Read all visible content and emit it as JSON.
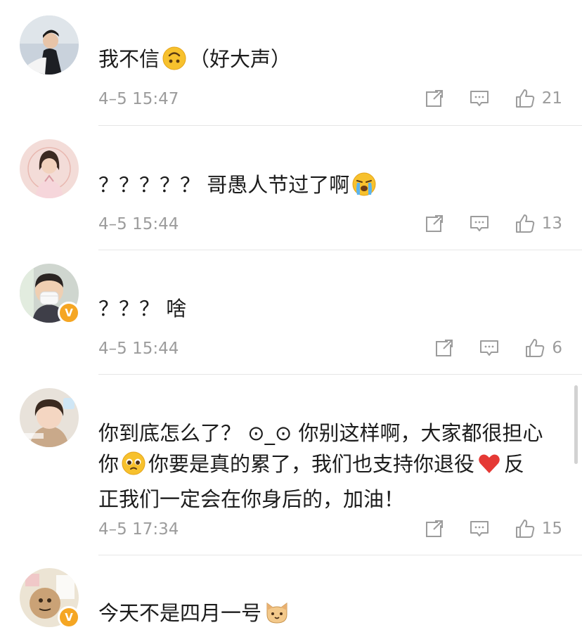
{
  "comments": [
    {
      "text_parts": [
        "我不信",
        "（好大声）"
      ],
      "emoji": "upside-down-face",
      "time": "4–5 15:47",
      "likes": "21",
      "verified": false
    },
    {
      "text_parts": [
        "？？？？？ 哥愚人节过了啊",
        ""
      ],
      "emoji": "loudly-crying-face",
      "time": "4–5 15:44",
      "likes": "13",
      "verified": false
    },
    {
      "text_parts": [
        "？？？ 啥"
      ],
      "time": "4–5 15:44",
      "likes": "6",
      "verified": true
    },
    {
      "line1": "你到底怎么了？ ⊙_⊙ 你别这样啊，大家都很担心",
      "line2a": "你",
      "line2b": "你要是真的累了，我们也支持你退役",
      "line2c": "反",
      "line3": "正我们一定会在你身后的，加油！",
      "time": "4–5 17:34",
      "likes": "15",
      "verified": false
    },
    {
      "text_parts": [
        "今天不是四月一号"
      ],
      "emoji": "cat-face",
      "verified": true
    }
  ],
  "badge": "V",
  "colors": {
    "icon_gray": "#9c9c9c",
    "verified": "#f5a623",
    "heart": "#e53935"
  }
}
